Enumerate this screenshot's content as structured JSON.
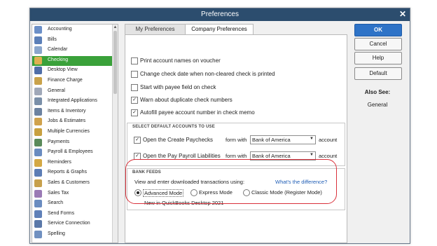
{
  "window": {
    "title": "Preferences",
    "close_glyph": "✕"
  },
  "sidebar": {
    "items": [
      {
        "label": "Accounting",
        "icon": "accounting-icon",
        "color": "#6b8fc7"
      },
      {
        "label": "Bills",
        "icon": "bills-icon",
        "color": "#5b7fb8"
      },
      {
        "label": "Calendar",
        "icon": "calendar-icon",
        "color": "#8aa6cc"
      },
      {
        "label": "Checking",
        "icon": "checking-icon",
        "color": "#e0b050"
      },
      {
        "label": "Desktop View",
        "icon": "desktop-view-icon",
        "color": "#4f6ea8"
      },
      {
        "label": "Finance Charge",
        "icon": "finance-charge-icon",
        "color": "#c9a24a"
      },
      {
        "label": "General",
        "icon": "general-icon",
        "color": "#a0a8b8"
      },
      {
        "label": "Integrated Applications",
        "icon": "integrated-applications-icon",
        "color": "#7a8fa8"
      },
      {
        "label": "Items & Inventory",
        "icon": "items-inventory-icon",
        "color": "#6c82a0"
      },
      {
        "label": "Jobs & Estimates",
        "icon": "jobs-estimates-icon",
        "color": "#d0a24c"
      },
      {
        "label": "Multiple Currencies",
        "icon": "multiple-currencies-icon",
        "color": "#c8a040"
      },
      {
        "label": "Payments",
        "icon": "payments-icon",
        "color": "#5a8a5a"
      },
      {
        "label": "Payroll & Employees",
        "icon": "payroll-employees-icon",
        "color": "#6a8cc0"
      },
      {
        "label": "Reminders",
        "icon": "reminders-icon",
        "color": "#d4a844"
      },
      {
        "label": "Reports & Graphs",
        "icon": "reports-graphs-icon",
        "color": "#5c7db5"
      },
      {
        "label": "Sales & Customers",
        "icon": "sales-customers-icon",
        "color": "#c7a04c"
      },
      {
        "label": "Sales Tax",
        "icon": "sales-tax-icon",
        "color": "#9a7ab5"
      },
      {
        "label": "Search",
        "icon": "search-icon",
        "color": "#6a8cc0"
      },
      {
        "label": "Send Forms",
        "icon": "send-forms-icon",
        "color": "#5f80b8"
      },
      {
        "label": "Service Connection",
        "icon": "service-connection-icon",
        "color": "#5a78a8"
      },
      {
        "label": "Spelling",
        "icon": "spelling-icon",
        "color": "#7090c0"
      }
    ],
    "selected_index": 3,
    "selected_color": "#3aa13a"
  },
  "tabs": [
    {
      "label": "My Preferences"
    },
    {
      "label": "Company Preferences"
    }
  ],
  "options": [
    {
      "label": "Print account names on voucher",
      "checked": false
    },
    {
      "label": "Change check date when non-cleared check is printed",
      "checked": false
    },
    {
      "label": "Start with payee field on check",
      "checked": false
    },
    {
      "label": "Warn about duplicate check numbers",
      "checked": true
    },
    {
      "label": "Autofill payee account number in check memo",
      "checked": true
    }
  ],
  "default_accounts": {
    "title": "SELECT DEFAULT ACCOUNTS TO USE",
    "rows": [
      {
        "label": "Open the Create Paychecks",
        "checked": true,
        "form_with": "form with",
        "account": "Bank of America",
        "suffix": "account"
      },
      {
        "label": "Open the Pay Payroll Liabilities",
        "checked": true,
        "form_with": "form with",
        "account": "Bank of America",
        "suffix": "account"
      }
    ]
  },
  "bank_feeds": {
    "title": "BANK FEEDS",
    "prompt": "View and enter downloaded transactions using:",
    "link": "What's the difference?",
    "modes": [
      {
        "label": "Advanced Mode",
        "selected": true
      },
      {
        "label": "Express Mode",
        "selected": false
      },
      {
        "label": "Classic Mode (Register Mode)",
        "selected": false
      }
    ],
    "note": "New in QuickBooks Desktop 2021",
    "highlight_color": "#d9313b"
  },
  "buttons": {
    "ok": "OK",
    "cancel": "Cancel",
    "help": "Help",
    "default": "Default"
  },
  "also_see": {
    "title": "Also See:",
    "items": [
      "General"
    ]
  },
  "colors": {
    "titlebar": "#2c4d6e",
    "ok_button": "#2e73c7",
    "link": "#1e5db5"
  }
}
